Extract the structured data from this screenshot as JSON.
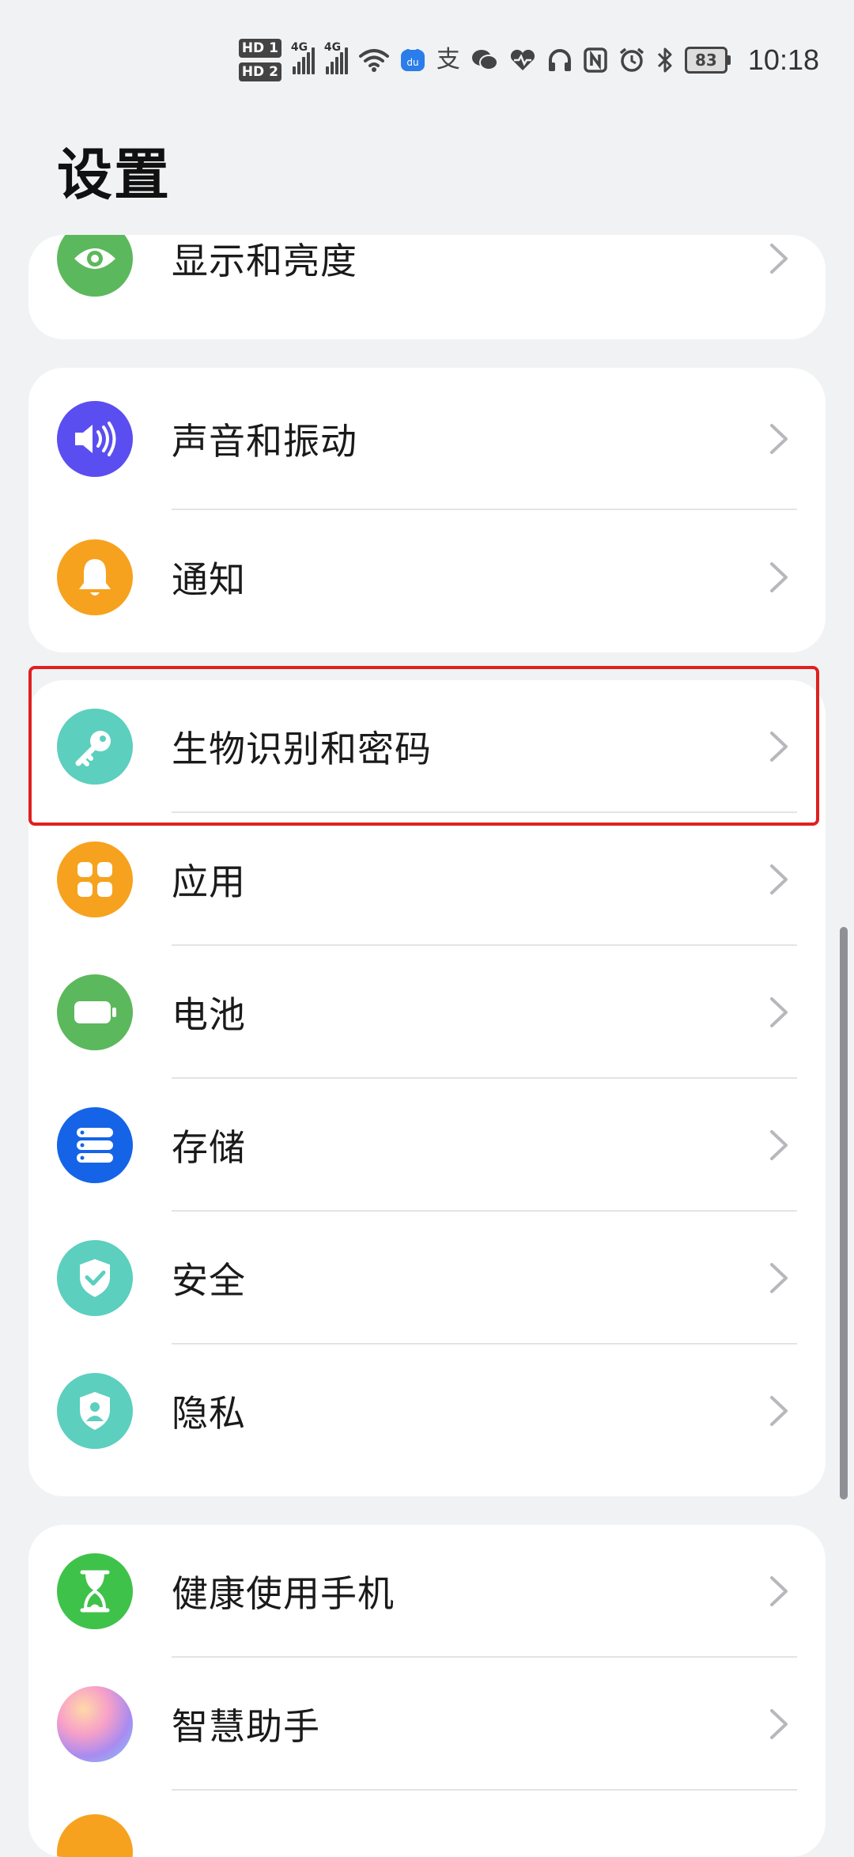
{
  "status_bar": {
    "hd1": "HD 1",
    "hd2": "HD 2",
    "net1": "4G",
    "net2": "4G",
    "battery": "83",
    "time": "10:18"
  },
  "page": {
    "title": "设置"
  },
  "cards": {
    "c0": {
      "display": "显示和亮度"
    },
    "c1": {
      "sound": "声音和振动",
      "notify": "通知"
    },
    "c2": {
      "biometrics": "生物识别和密码",
      "apps": "应用",
      "battery": "电池",
      "storage": "存储",
      "security": "安全",
      "privacy": "隐私"
    },
    "c3": {
      "wellbeing": "健康使用手机",
      "assistant": "智慧助手"
    }
  },
  "colors": {
    "display": "#5cb85c",
    "sound": "#5b4ef0",
    "notify": "#f6a21e",
    "biometrics": "#5ccfbe",
    "apps": "#f6a21e",
    "battery": "#5cb85c",
    "storage": "#1564e8",
    "security": "#5ccfbe",
    "privacy": "#5ccfbe",
    "wellbeing": "#3fc24a",
    "highlight": "#e02020"
  }
}
